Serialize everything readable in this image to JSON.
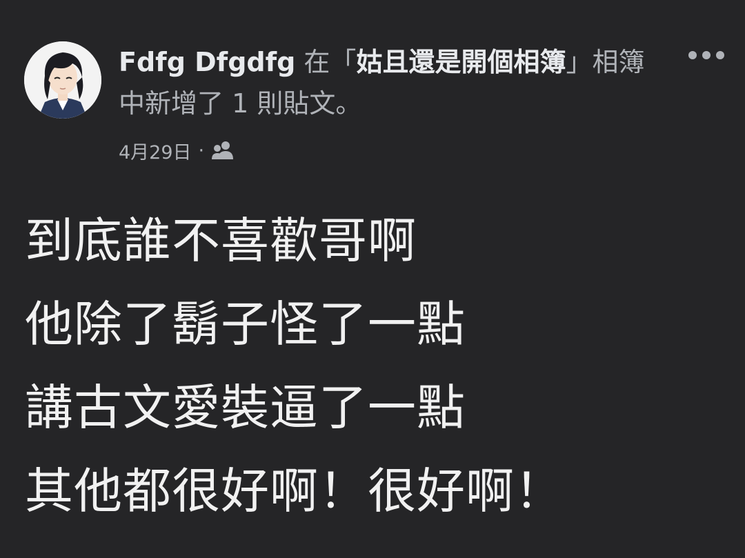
{
  "post": {
    "author": "Fdfg Dfgdfg",
    "connector": " 在「",
    "album_name": "姑且還是開個相簿",
    "suffix": "」相簿中新增了 1 則貼文。",
    "date": "4月29日",
    "separator": "·",
    "audience_icon": "friends-icon",
    "more_icon": "more-horizontal-icon",
    "avatar_icon": "avatar-image",
    "lines": [
      "到底誰不喜歡哥啊",
      "他除了鬍子怪了一點",
      "講古文愛裝逼了一點",
      "其他都很好啊！很好啊！"
    ]
  },
  "colors": {
    "background": "#252527",
    "primary_text": "#f1f1f1",
    "secondary_text": "#b0b3b8"
  }
}
